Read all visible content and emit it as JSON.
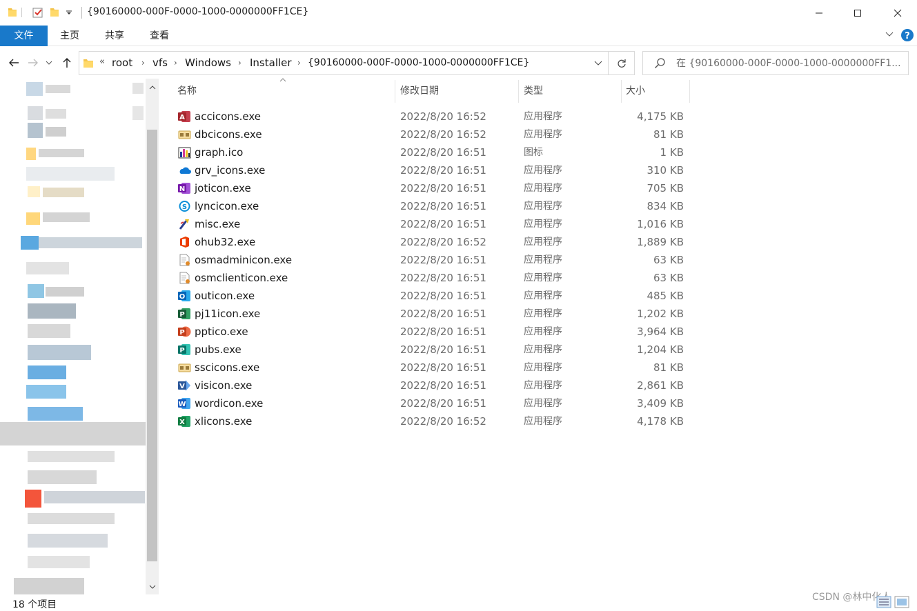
{
  "window": {
    "title": "{90160000-000F-0000-1000-0000000FF1CE}",
    "minimize_glyph": "─",
    "maximize_glyph": "☐",
    "close_glyph": "✕"
  },
  "ribbon": {
    "tabs": [
      "文件",
      "主页",
      "共享",
      "查看"
    ]
  },
  "address": {
    "overflow_glyph": "«",
    "crumbs": [
      "root",
      "vfs",
      "Windows",
      "Installer",
      "{90160000-000F-0000-1000-0000000FF1CE}"
    ]
  },
  "search": {
    "placeholder": "在 {90160000-000F-0000-1000-0000000FF1..."
  },
  "columns": {
    "name": "名称",
    "date": "修改日期",
    "type": "类型",
    "size": "大小"
  },
  "files": [
    {
      "name": "accicons.exe",
      "date": "2022/8/20 16:52",
      "type": "应用程序",
      "size": "4,175 KB",
      "icon": "access-icon"
    },
    {
      "name": "dbcicons.exe",
      "date": "2022/8/20 16:52",
      "type": "应用程序",
      "size": "81 KB",
      "icon": "generic-exe-icon"
    },
    {
      "name": "graph.ico",
      "date": "2022/8/20 16:51",
      "type": "图标",
      "size": "1 KB",
      "icon": "graph-icon"
    },
    {
      "name": "grv_icons.exe",
      "date": "2022/8/20 16:51",
      "type": "应用程序",
      "size": "310 KB",
      "icon": "onedrive-icon"
    },
    {
      "name": "joticon.exe",
      "date": "2022/8/20 16:51",
      "type": "应用程序",
      "size": "705 KB",
      "icon": "onenote-icon"
    },
    {
      "name": "lyncicon.exe",
      "date": "2022/8/20 16:51",
      "type": "应用程序",
      "size": "834 KB",
      "icon": "skype-icon"
    },
    {
      "name": "misc.exe",
      "date": "2022/8/20 16:51",
      "type": "应用程序",
      "size": "1,016 KB",
      "icon": "misc-icon"
    },
    {
      "name": "ohub32.exe",
      "date": "2022/8/20 16:52",
      "type": "应用程序",
      "size": "1,889 KB",
      "icon": "office-icon"
    },
    {
      "name": "osmadminicon.exe",
      "date": "2022/8/20 16:51",
      "type": "应用程序",
      "size": "63 KB",
      "icon": "setup-file-icon"
    },
    {
      "name": "osmclienticon.exe",
      "date": "2022/8/20 16:51",
      "type": "应用程序",
      "size": "63 KB",
      "icon": "setup-file-icon"
    },
    {
      "name": "outicon.exe",
      "date": "2022/8/20 16:51",
      "type": "应用程序",
      "size": "485 KB",
      "icon": "outlook-icon"
    },
    {
      "name": "pj11icon.exe",
      "date": "2022/8/20 16:51",
      "type": "应用程序",
      "size": "1,202 KB",
      "icon": "project-icon"
    },
    {
      "name": "pptico.exe",
      "date": "2022/8/20 16:51",
      "type": "应用程序",
      "size": "3,964 KB",
      "icon": "powerpoint-icon"
    },
    {
      "name": "pubs.exe",
      "date": "2022/8/20 16:51",
      "type": "应用程序",
      "size": "1,204 KB",
      "icon": "publisher-icon"
    },
    {
      "name": "sscicons.exe",
      "date": "2022/8/20 16:51",
      "type": "应用程序",
      "size": "81 KB",
      "icon": "generic-exe-icon"
    },
    {
      "name": "visicon.exe",
      "date": "2022/8/20 16:51",
      "type": "应用程序",
      "size": "2,861 KB",
      "icon": "visio-icon"
    },
    {
      "name": "wordicon.exe",
      "date": "2022/8/20 16:51",
      "type": "应用程序",
      "size": "3,409 KB",
      "icon": "word-icon"
    },
    {
      "name": "xlicons.exe",
      "date": "2022/8/20 16:52",
      "type": "应用程序",
      "size": "4,178 KB",
      "icon": "excel-icon"
    }
  ],
  "status": {
    "item_count": "18 个项目"
  },
  "watermark": "CSDN @林中化人",
  "colors": {
    "file_tab": "#1979ca",
    "help_button": "#1979ca"
  }
}
